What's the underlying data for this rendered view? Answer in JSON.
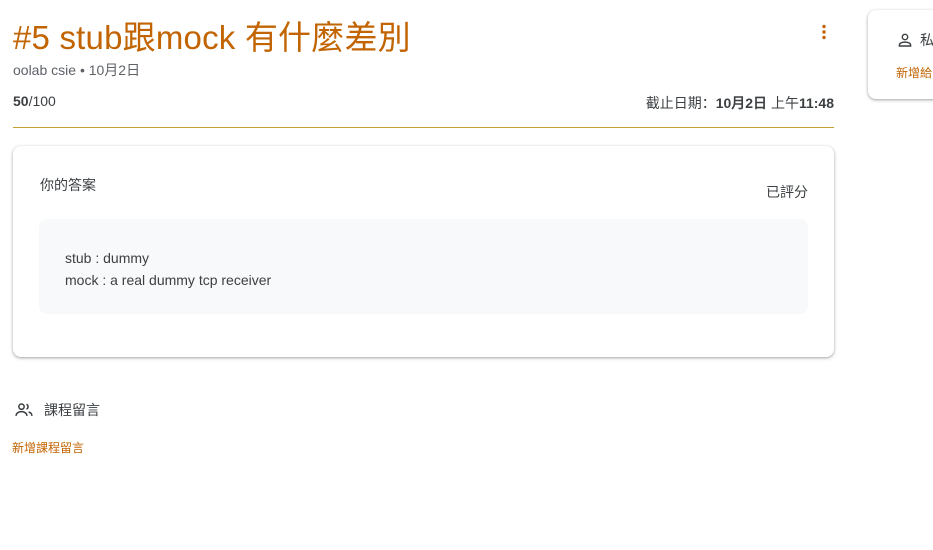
{
  "assignment": {
    "title": "#5 stub跟mock 有什麼差別",
    "author": "oolab csie",
    "separator": "•",
    "posted_date": "10月2日",
    "points_earned": "50",
    "points_total": "/100",
    "due_label": "截止日期：",
    "due_date": "10月2日",
    "due_time_prefix": "上午",
    "due_time": "11:48"
  },
  "icons": {
    "more": "more-vert-icon",
    "class_comments": "people-icon",
    "private_comments": "person-icon"
  },
  "answer_card": {
    "title": "你的答案",
    "status": "已評分",
    "lines": [
      "stub : dummy",
      "mock : a real dummy tcp receiver"
    ]
  },
  "class_comments": {
    "label": "課程留言",
    "add_link": "新增課程留言"
  },
  "private_comments": {
    "label": "私",
    "add_link": "新增給"
  },
  "colors": {
    "accent": "#c26401",
    "divider": "#c7a033",
    "text": "#3c4043",
    "muted": "#5f6368",
    "answer_bg": "#f8f9fa"
  }
}
